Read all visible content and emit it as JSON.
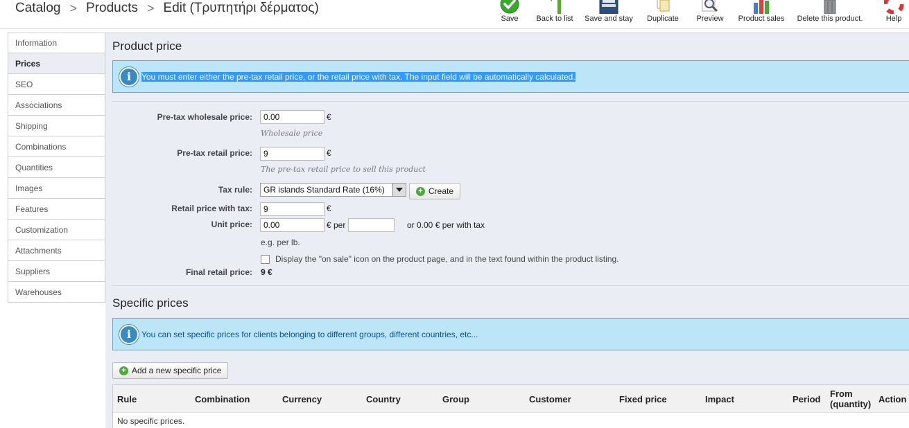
{
  "breadcrumb": [
    "Catalog",
    "Products",
    "Edit (Τρυπητήρι δέρματος)"
  ],
  "toolbar": [
    {
      "label": "Save",
      "icon": "check-icon"
    },
    {
      "label": "Back to list",
      "icon": "back-arrow-icon"
    },
    {
      "label": "Save and stay",
      "icon": "save-disk-icon"
    },
    {
      "label": "Duplicate",
      "icon": "duplicate-icon"
    },
    {
      "label": "Preview",
      "icon": "magnifier-icon"
    },
    {
      "label": "Product sales",
      "icon": "bar-chart-icon"
    },
    {
      "label": "Delete this product.",
      "icon": "trash-icon"
    },
    {
      "label": "Help",
      "icon": "lifebuoy-icon"
    }
  ],
  "sidebar": [
    {
      "label": "Information",
      "active": false
    },
    {
      "label": "Prices",
      "active": true
    },
    {
      "label": "SEO",
      "active": false
    },
    {
      "label": "Associations",
      "active": false
    },
    {
      "label": "Shipping",
      "active": false
    },
    {
      "label": "Combinations",
      "active": false
    },
    {
      "label": "Quantities",
      "active": false
    },
    {
      "label": "Images",
      "active": false
    },
    {
      "label": "Features",
      "active": false
    },
    {
      "label": "Customization",
      "active": false
    },
    {
      "label": "Attachments",
      "active": false
    },
    {
      "label": "Suppliers",
      "active": false
    },
    {
      "label": "Warehouses",
      "active": false
    }
  ],
  "product_price": {
    "title": "Product price",
    "info": "You must enter either the pre-tax retail price, or the retail price with tax. The input field will be automatically calculated.",
    "wholesale": {
      "label": "Pre-tax wholesale price:",
      "value": "0.00",
      "unit": "€",
      "hint": "Wholesale price"
    },
    "retail": {
      "label": "Pre-tax retail price:",
      "value": "9",
      "unit": "€",
      "hint": "The pre-tax retail price to sell this product"
    },
    "tax_rule": {
      "label": "Tax rule:",
      "selected": "GR islands Standard Rate (16%)",
      "create_label": "Create"
    },
    "retail_with_tax": {
      "label": "Retail price with tax:",
      "value": "9",
      "unit": "€"
    },
    "unit_price": {
      "label": "Unit price:",
      "value": "0.00",
      "unit": "€ per",
      "per_value": "",
      "with_tax": "or 0.00 € per with tax",
      "hint": "e.g. per lb."
    },
    "on_sale": {
      "label": "Display the \"on sale\" icon on the product page, and in the text found within the product listing.",
      "checked": false
    },
    "final": {
      "label": "Final retail price:",
      "value": "9 €"
    }
  },
  "specific_prices": {
    "title": "Specific prices",
    "info": "You can set specific prices for clients belonging to different groups, different countries, etc...",
    "add_label": "Add a new specific price",
    "columns": [
      "Rule",
      "Combination",
      "Currency",
      "Country",
      "Group",
      "Customer",
      "Fixed price",
      "Impact",
      "Period",
      "From (quantity)",
      "Action"
    ],
    "empty_text": "No specific prices."
  },
  "colors": {
    "accent": "#3a89c0",
    "info_bg": "#bde5f8",
    "panel_bg": "#ebedf4",
    "add_icon": "#4caa3c"
  }
}
